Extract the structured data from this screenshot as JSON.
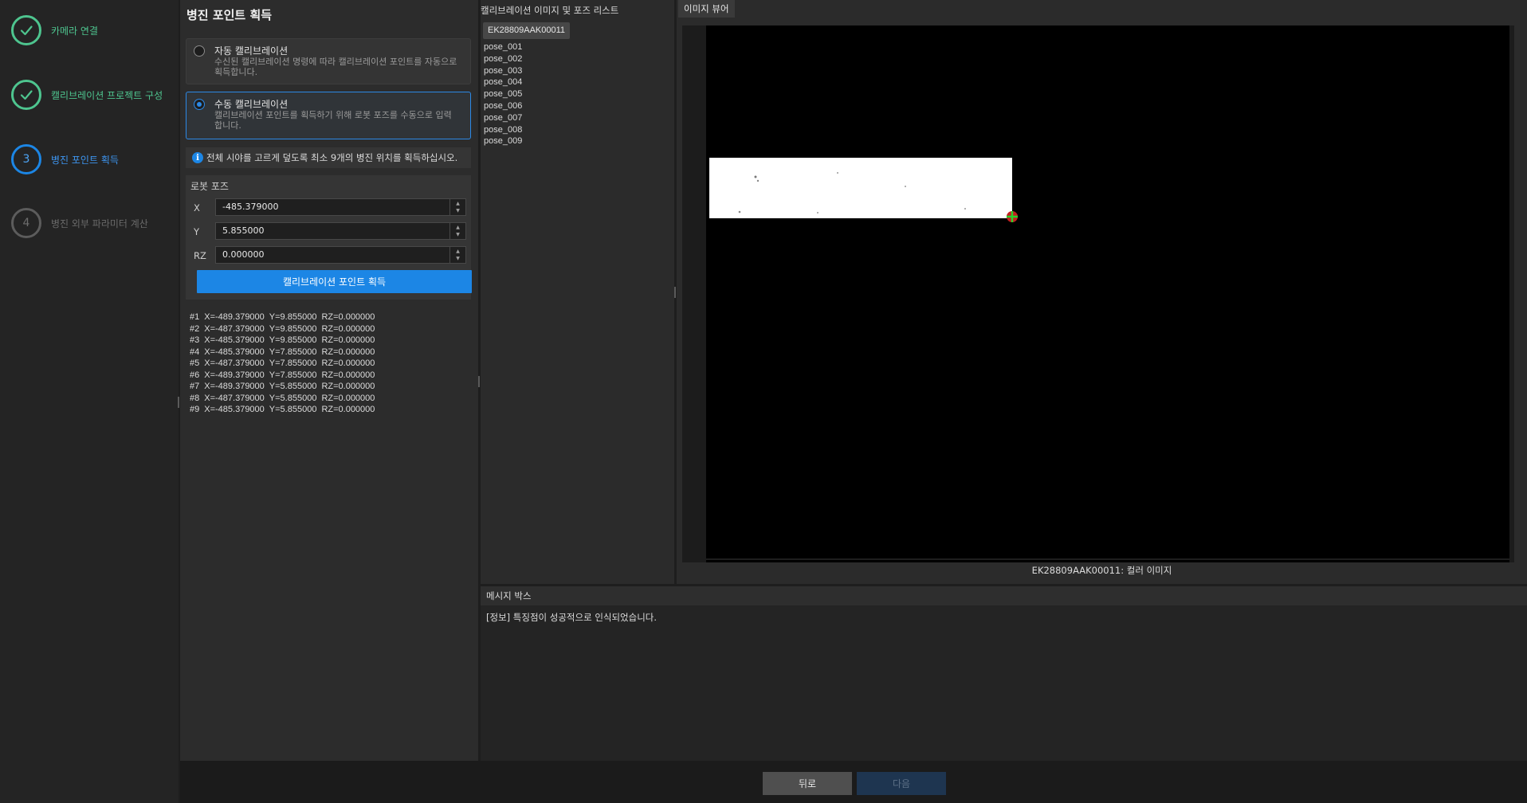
{
  "sidebar": {
    "steps": [
      {
        "number": "",
        "label": "카메라 연결",
        "state": "done"
      },
      {
        "number": "",
        "label": "캘리브레이션 프로젝트 구성",
        "state": "done"
      },
      {
        "number": "3",
        "label": "병진 포인트 획득",
        "state": "current"
      },
      {
        "number": "4",
        "label": "병진 외부 파라미터 계산",
        "state": "pending"
      }
    ]
  },
  "left_panel": {
    "title": "병진 포인트 획득",
    "auto_option": {
      "title": "자동 캘리브레이션",
      "description": "수신된 캘리브레이션 명령에 따라 캘리브레이션 포인트를 자동으로 획득합니다."
    },
    "manual_option": {
      "title": "수동 캘리브레이션",
      "description": "캘리브레이션 포인트를 획득하기 위해 로봇 포즈를 수동으로 입력합니다."
    },
    "info_text": "전체 시야를 고르게 덮도록 최소 9개의 병진 위치를 획득하십시오.",
    "robot_pose": {
      "title": "로봇 포즈",
      "x_label": "X",
      "x_value": "-485.379000",
      "y_label": "Y",
      "y_value": "5.855000",
      "rz_label": "RZ",
      "rz_value": "0.000000"
    },
    "capture_button_label": "캘리브레이션 포인트 획득",
    "points": [
      {
        "id": "#1",
        "x": "X=-489.379000",
        "y": "Y=9.855000",
        "rz": "RZ=0.000000"
      },
      {
        "id": "#2",
        "x": "X=-487.379000",
        "y": "Y=9.855000",
        "rz": "RZ=0.000000"
      },
      {
        "id": "#3",
        "x": "X=-485.379000",
        "y": "Y=9.855000",
        "rz": "RZ=0.000000"
      },
      {
        "id": "#4",
        "x": "X=-485.379000",
        "y": "Y=7.855000",
        "rz": "RZ=0.000000"
      },
      {
        "id": "#5",
        "x": "X=-487.379000",
        "y": "Y=7.855000",
        "rz": "RZ=0.000000"
      },
      {
        "id": "#6",
        "x": "X=-489.379000",
        "y": "Y=7.855000",
        "rz": "RZ=0.000000"
      },
      {
        "id": "#7",
        "x": "X=-489.379000",
        "y": "Y=5.855000",
        "rz": "RZ=0.000000"
      },
      {
        "id": "#8",
        "x": "X=-487.379000",
        "y": "Y=5.855000",
        "rz": "RZ=0.000000"
      },
      {
        "id": "#9",
        "x": "X=-485.379000",
        "y": "Y=5.855000",
        "rz": "RZ=0.000000"
      }
    ]
  },
  "middle_panel": {
    "title": "캘리브레이션 이미지 및 포즈 리스트",
    "camera_tab": "EK28809AAK00011",
    "poses": [
      "pose_001",
      "pose_002",
      "pose_003",
      "pose_004",
      "pose_005",
      "pose_006",
      "pose_007",
      "pose_008",
      "pose_009"
    ]
  },
  "viewer": {
    "tab_label": "이미지 뷰어",
    "caption": "EK28809AAK00011: 컬러 이미지"
  },
  "messages": {
    "header": "메시지 박스",
    "text": "[정보] 특징점이 성공적으로 인식되었습니다."
  },
  "footer": {
    "back_label": "뒤로",
    "next_label": "다음"
  },
  "colors": {
    "accent": "#1c86e5",
    "done": "#4ec58f",
    "pending": "#5c5c5c"
  }
}
